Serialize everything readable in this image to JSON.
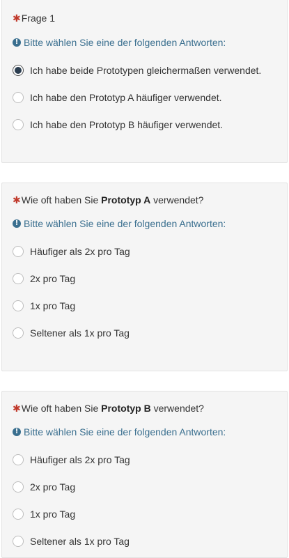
{
  "asterisk": "✱",
  "hint_text": "Bitte wählen Sie eine der folgenden Antworten:",
  "q1": {
    "title": "Frage 1",
    "options": [
      "Ich habe beide Prototypen gleichermaßen verwendet.",
      "Ich habe den Prototyp A häufiger verwendet.",
      "Ich habe den Prototyp B häufiger verwendet."
    ],
    "selected_index": 0
  },
  "q2": {
    "title_before": "Wie oft haben Sie ",
    "title_bold": "Prototyp A",
    "title_after": " verwendet?",
    "options": [
      "Häufiger als 2x pro Tag",
      "2x pro Tag",
      "1x pro Tag",
      "Seltener als 1x pro Tag"
    ]
  },
  "q3": {
    "title_before": "Wie oft haben Sie ",
    "title_bold": "Prototyp B",
    "title_after": " verwendet?",
    "options": [
      "Häufiger als 2x pro Tag",
      "2x pro Tag",
      "1x pro Tag",
      "Seltener als 1x pro Tag"
    ]
  },
  "colors": {
    "panel_bg": "#f5f5f5",
    "required_asterisk": "#c0392b",
    "hint": "#3a6f8f",
    "selected_radio": "#2c3e50"
  },
  "icons": {
    "required": "asterisk-icon",
    "hint": "info-icon"
  }
}
